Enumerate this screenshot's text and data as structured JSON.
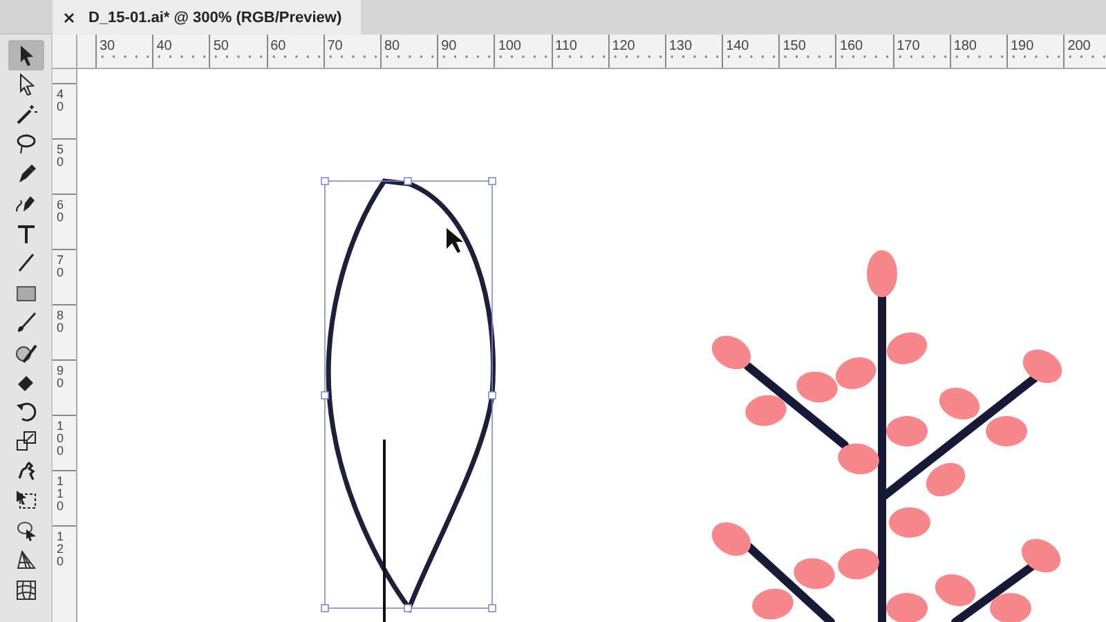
{
  "document_tab": {
    "title": "D_15-01.ai* @ 300% (RGB/Preview)"
  },
  "tools": [
    {
      "selected": true
    },
    {
      "selected": false
    },
    {
      "selected": false
    },
    {
      "selected": false
    },
    {
      "selected": false
    },
    {
      "selected": false
    },
    {
      "selected": false
    },
    {
      "selected": false
    },
    {
      "selected": false
    },
    {
      "selected": false
    },
    {
      "selected": false
    },
    {
      "selected": false
    },
    {
      "selected": false
    },
    {
      "selected": false
    },
    {
      "selected": false
    },
    {
      "selected": false
    },
    {
      "selected": false
    },
    {
      "selected": false
    },
    {
      "selected": false
    }
  ],
  "horizontal_ruler": [
    "30",
    "40",
    "50",
    "60",
    "70",
    "80",
    "90",
    "100",
    "110",
    "120",
    "130",
    "140",
    "150",
    "160",
    "170",
    "180",
    "190",
    "200"
  ],
  "vertical_ruler": [
    "40",
    "50",
    "60",
    "70",
    "80",
    "90",
    "100",
    "110",
    "120"
  ]
}
